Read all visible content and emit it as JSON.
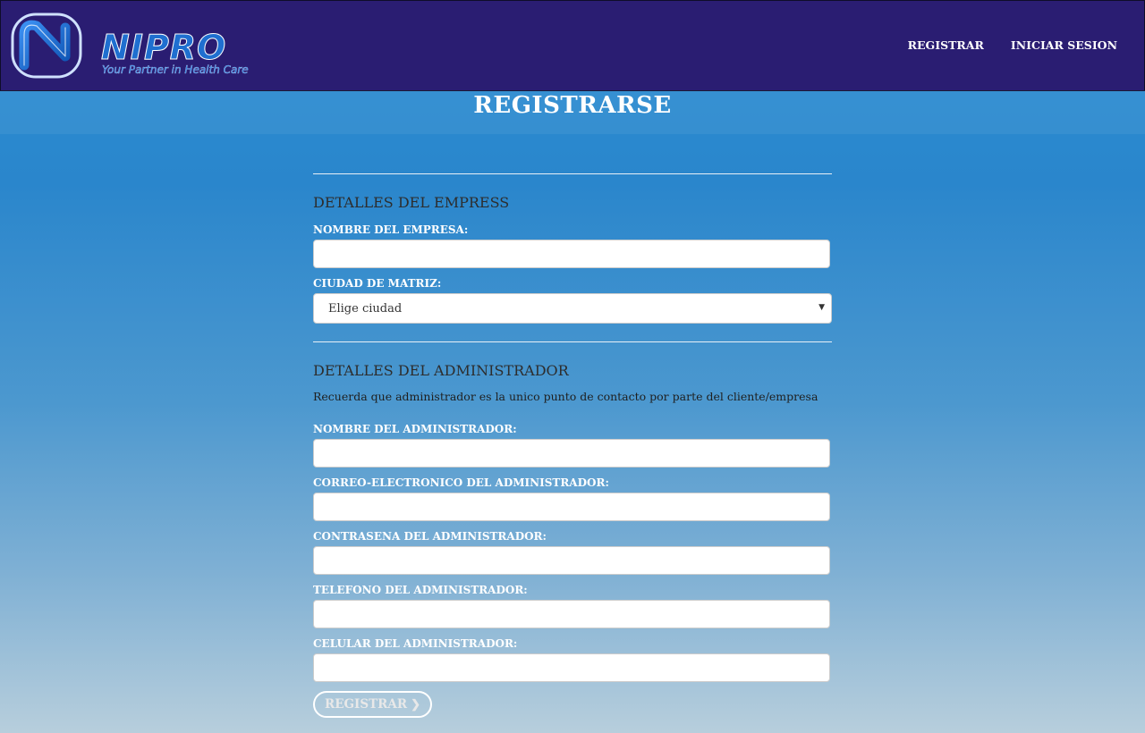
{
  "header": {
    "brand_name": "NIPRO",
    "tagline": "Your Partner in Health Care",
    "nav": [
      {
        "label": "REGISTRAR"
      },
      {
        "label": "INICIAR SESION"
      }
    ]
  },
  "page": {
    "title": "REGISTRARSE"
  },
  "company_section": {
    "title": "DETALLES DEL EMPRESS",
    "name_label": "NOMBRE DEL EMPRESA:",
    "city_label": "CIUDAD DE MATRIZ:",
    "city_selected": "Elige ciudad"
  },
  "admin_section": {
    "title": "DETALLES DEL ADMINISTRADOR",
    "note": "Recuerda que administrador es la unico punto de contacto por parte del cliente/empresa",
    "fields": [
      {
        "label": "NOMBRE DEL ADMINISTRADOR:"
      },
      {
        "label": "CORREO-ELECTRONICO DEL ADMINISTRADOR:"
      },
      {
        "label": "CONTRASENA DEL ADMINISTRADOR:"
      },
      {
        "label": "TELEFONO DEL ADMINISTRADOR:"
      },
      {
        "label": "CELULAR DEL ADMINISTRADOR:"
      }
    ]
  },
  "submit": {
    "label": "REGISTRAR",
    "icon": "chevron-right-icon"
  },
  "colors": {
    "navbar": "#2a1d72",
    "brand_blue": "#1f6fd0",
    "background_top": "#2b8fd4",
    "background_bottom": "#b7cedc"
  }
}
